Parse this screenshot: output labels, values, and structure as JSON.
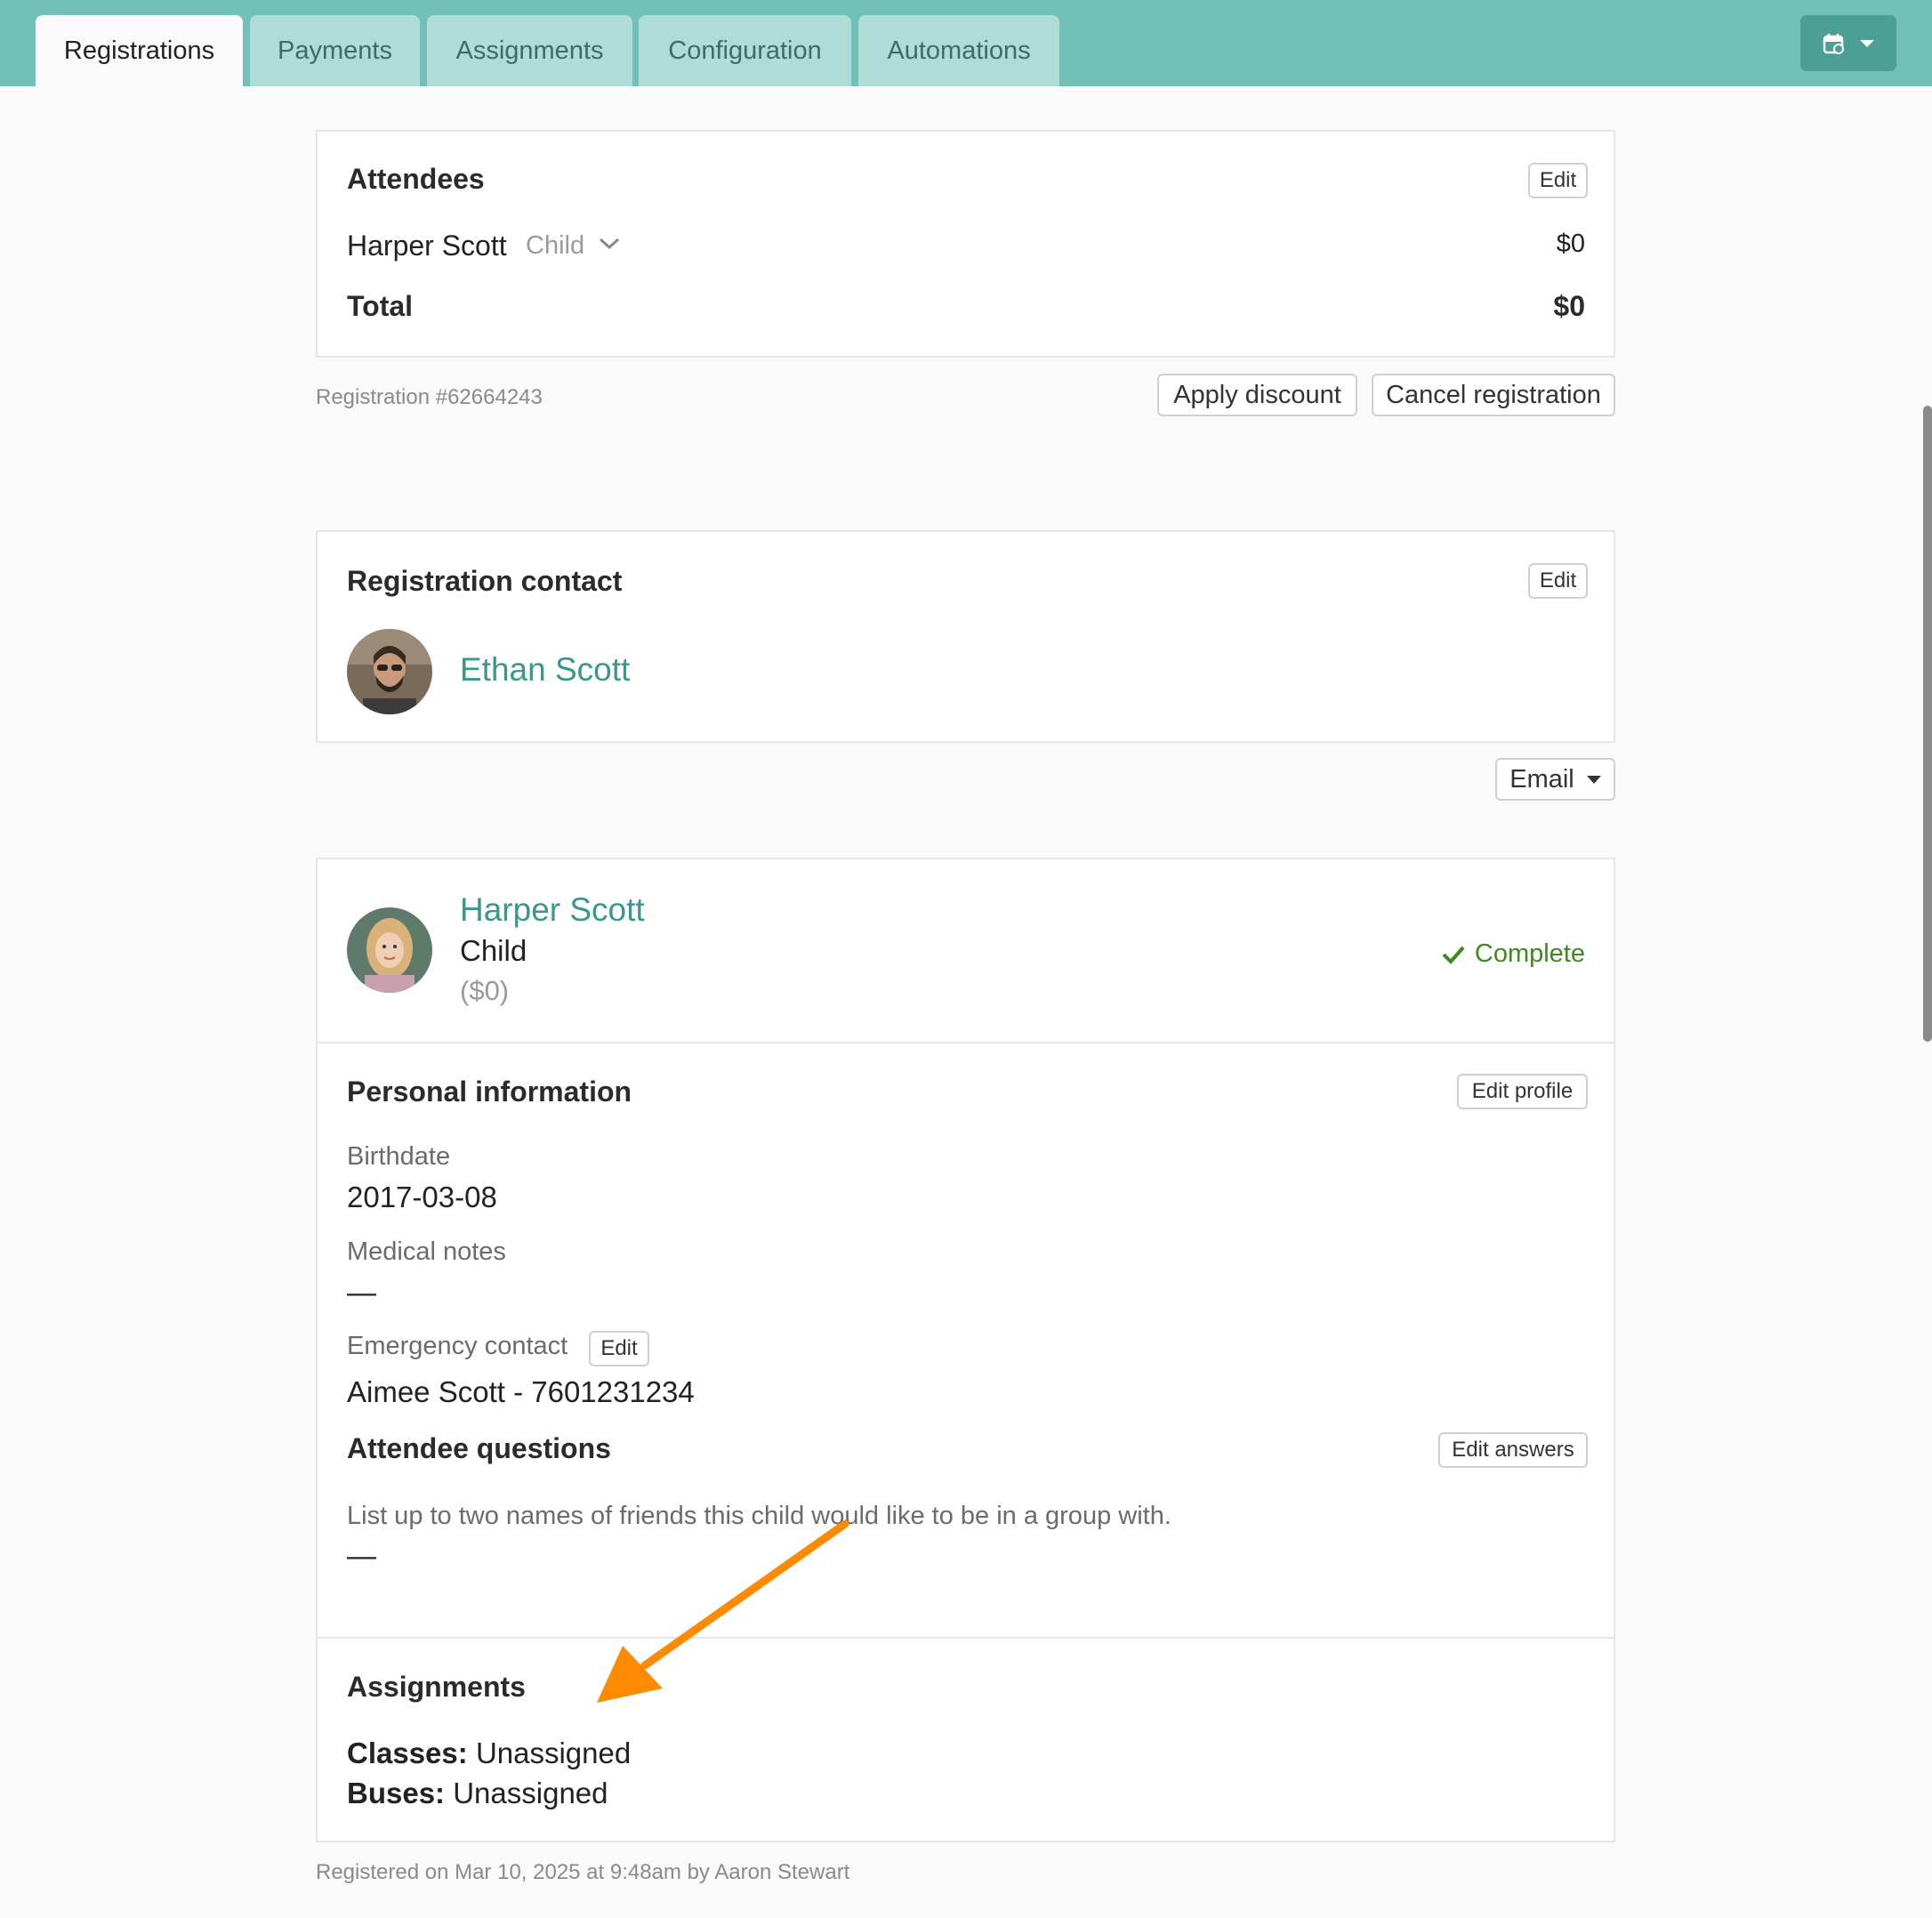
{
  "tabs": [
    {
      "label": "Registrations",
      "active": true
    },
    {
      "label": "Payments"
    },
    {
      "label": "Assignments"
    },
    {
      "label": "Configuration"
    },
    {
      "label": "Automations"
    }
  ],
  "toolbar": {
    "calendar_icon": "calendar-link-icon"
  },
  "attendees": {
    "title": "Attendees",
    "edit_label": "Edit",
    "rows": [
      {
        "name": "Harper Scott",
        "type": "Child",
        "amount": "$0"
      }
    ],
    "total_label": "Total",
    "total_amount": "$0"
  },
  "registration": {
    "number": "Registration #62664243",
    "apply_discount": "Apply discount",
    "cancel": "Cancel registration"
  },
  "contact": {
    "title": "Registration contact",
    "edit_label": "Edit",
    "name": "Ethan Scott",
    "email_button": "Email"
  },
  "attendee": {
    "name": "Harper Scott",
    "type": "Child",
    "amount": "($0)",
    "status": "Complete",
    "status_color": "#3d8a1e",
    "personal_title": "Personal information",
    "edit_profile": "Edit profile",
    "birthdate_label": "Birthdate",
    "birthdate": "2017-03-08",
    "medical_label": "Medical notes",
    "medical": "—",
    "emergency_label": "Emergency contact",
    "emergency_edit": "Edit",
    "emergency": "Aimee Scott - 7601231234",
    "questions_title": "Attendee questions",
    "edit_answers": "Edit answers",
    "question": "List up to two names of friends this child would like to be in a group with.",
    "answer": "—",
    "assignments_title": "Assignments",
    "classes_label": "Classes:",
    "classes_value": "Unassigned",
    "buses_label": "Buses:",
    "buses_value": "Unassigned"
  },
  "footer": "Registered on Mar 10, 2025 at 9:48am by Aaron Stewart",
  "colors": {
    "accent": "#72c1b9",
    "link": "#3a978c",
    "arrow": "#ff8a00"
  }
}
